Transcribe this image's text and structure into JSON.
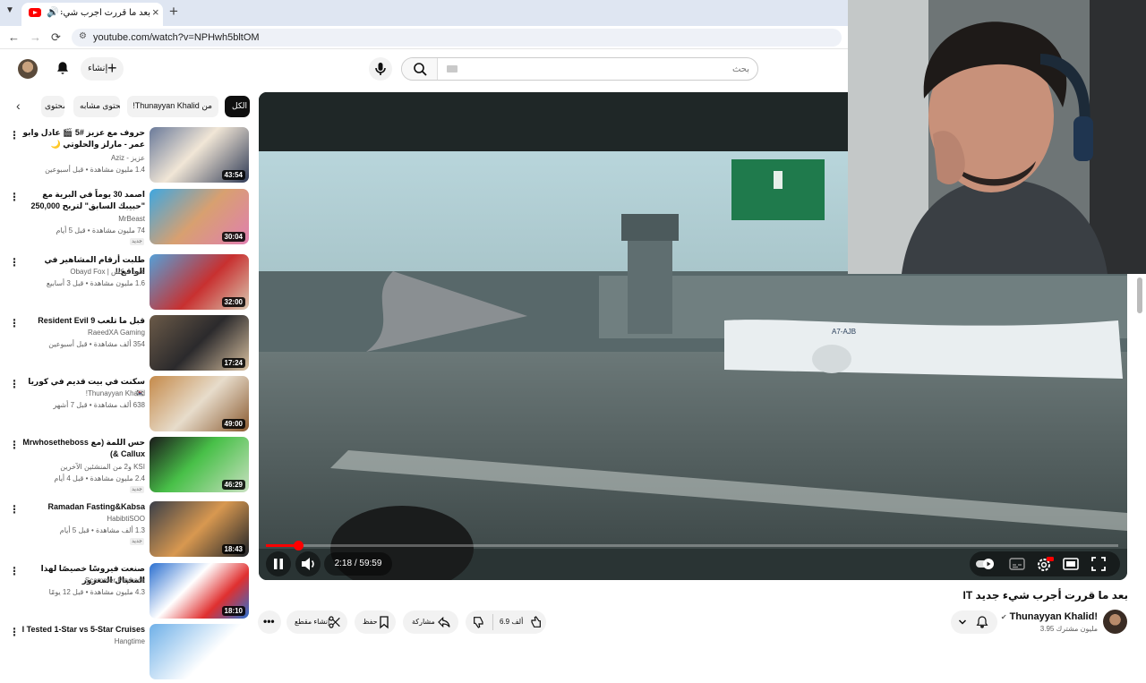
{
  "browser": {
    "tab_title": "بعد ما قررت أجرب شيء جديد",
    "url": "youtube.com/watch?v=NPHwh5bltOM"
  },
  "header": {
    "create_label": "إنشاء",
    "search_placeholder": "بحث"
  },
  "chips": [
    {
      "label": "الكل"
    },
    {
      "label": "من Thunayyan Khalid!"
    },
    {
      "label": "محتوى مشابه"
    },
    {
      "label": "محتوى"
    }
  ],
  "sidebar_videos": [
    {
      "title": "حروف مع عزيز #5 🎬 عادل وابو عمر - مارلز والحلوتي 🌙الموسم الثالث",
      "channel": "عزيز - Aziz",
      "meta": "1.4 مليون مشاهدة • قبل أسبوعين",
      "duration": "43:54",
      "badge": ""
    },
    {
      "title": "اصمد 30 يوماً في البرية مع \"حبيبك السابق\" لتربح 250,000 دولار",
      "channel": "MrBeast",
      "meta": "74 مليون مشاهدة • قبل 5 أيام",
      "duration": "30:04",
      "badge": "جديد"
    },
    {
      "title": "طلبت أرقام المشاهير في الواقع!!",
      "channel": "عبيد فوكس | Obayd Fox",
      "meta": "1.6 مليون مشاهدة • قبل 3 أسابيع",
      "duration": "32:00",
      "badge": ""
    },
    {
      "title": "قبل ما تلعب Resident Evil 9",
      "channel": "RaeedXA Gaming",
      "meta": "354 ألف مشاهدة • قبل أسبوعين",
      "duration": "17:24",
      "badge": ""
    },
    {
      "title": "سكنت في بيت قديم في كوريا 🇰🇷",
      "channel": "Thunayyan Khalid!",
      "meta": "638 ألف مشاهدة • قبل 7 أشهر",
      "duration": "49:00",
      "badge": ""
    },
    {
      "title": "حس اللمة (مع Mrwhosetheboss & Callux)",
      "channel": "KSI و2 من المنشئين الآخرين",
      "meta": "2.4 مليون مشاهدة • قبل 4 أيام",
      "duration": "46:29",
      "badge": "جديد"
    },
    {
      "title": "Ramadan Fasting&Kabsa",
      "channel": "HabibtiSOO",
      "meta": "1.3 ألف مشاهدة • قبل 5 أيام",
      "duration": "18:43",
      "badge": "جديد"
    },
    {
      "title": "صنعت فيروسًا خصيصًا لهذا المحتال المغرور",
      "channel": "Scammer Payback",
      "meta": "4.3 مليون مشاهدة • قبل 12 يومًا",
      "duration": "18:10",
      "badge": ""
    },
    {
      "title": "I Tested 1-Star vs 5-Star Cruises",
      "channel": "Hangtime",
      "meta": "",
      "duration": "",
      "badge": ""
    }
  ],
  "player": {
    "current_time": "2:18",
    "duration": "59:59",
    "time_display": "2:18 / 59:59",
    "progress_fraction": 0.0383,
    "sign_text": "A7-AJB"
  },
  "video": {
    "title": "بعد ما قررت أجرب شيء جديد IT",
    "channel_name": "Thunayyan Khalid!",
    "subscribers": "3.95 مليون مشترك",
    "likes": "6.9 ألف",
    "share_label": "مشاركة",
    "save_label": "حفظ",
    "clip_label": "إنشاء مقطع"
  },
  "colors": {
    "accent": "#ff0000",
    "chip_active": "#0f0f0f",
    "chip_bg": "#f2f2f2"
  }
}
